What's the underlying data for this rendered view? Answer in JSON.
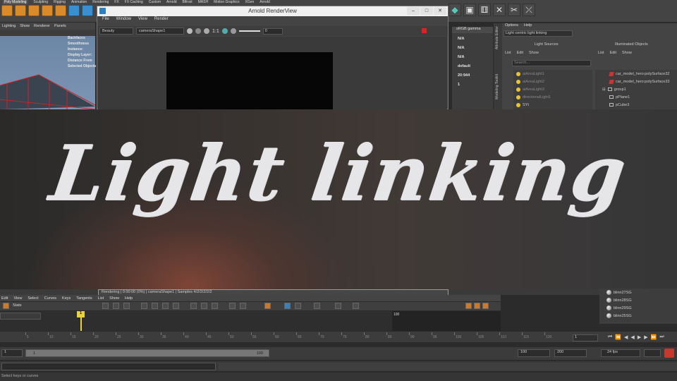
{
  "title_overlay": {
    "text": "Light linking"
  },
  "shelf": {
    "tabs": [
      "Poly Modeling",
      "Sculpting",
      "Rigging",
      "Animation",
      "Rendering",
      "FX",
      "FX Caching",
      "Custom",
      "Arnold",
      "Bifrost",
      "MASH",
      "Motion Graphics",
      "XGen",
      "Arnold"
    ],
    "active_tab": 0
  },
  "viewport": {
    "menus": [
      "Lighting",
      "Show",
      "Renderer",
      "Panels"
    ],
    "hud": [
      "Backfaces",
      "Smoothness",
      "Instance:",
      "Display Layer:",
      "Distance From",
      "Selected Objects"
    ]
  },
  "render_view": {
    "title": "Arnold RenderView",
    "menus": [
      "File",
      "Window",
      "View",
      "Render"
    ],
    "aov": "Beauty",
    "camera": "cameraShape1",
    "ratio": "1:1",
    "exposure": "0",
    "color_space": "sRGB gamma",
    "status": "Rendering | 0:00:00 (0%) | cameraShape1 | Samples 4/2/2/2/2/2"
  },
  "attr_values": [
    "N/A",
    "N/A",
    "N/A",
    "default",
    "20:944",
    "1"
  ],
  "side_tabs": [
    "Attribute Editor",
    "Modeling Toolkit"
  ],
  "light_linking": {
    "menus": [
      "Options",
      "Help"
    ],
    "mode": "Light centric light linking",
    "light_sources_title": "Light Sources",
    "illuminated_title": "Illuminated Objects",
    "light_menus": [
      "List",
      "Edit",
      "Show"
    ],
    "illum_menus": [
      "List",
      "Edit",
      "Show"
    ],
    "search_placeholder": "Search...",
    "lights": [
      "aiAreaLight1",
      "aiAreaLight2",
      "aiAreaLight3",
      "directionalLight1",
      "SYt"
    ],
    "objects": [
      "car_model_hero:polySurface32",
      "car_model_hero:polySurface33",
      "group1",
      "pPlane1",
      "pCube3"
    ]
  },
  "graph_editor": {
    "menus": [
      "Edit",
      "View",
      "Select",
      "Curves",
      "Keys",
      "Tangents",
      "List",
      "Show",
      "Help"
    ],
    "stats_label": "Stats",
    "current_frame": "1",
    "marker_end": "100"
  },
  "hypershade_items": [
    "blinn27SG",
    "blinn28SG",
    "blinn29SG",
    "blinn25SG",
    "blinn26SG"
  ],
  "timeline": {
    "end_field": "1",
    "tick_labels": [
      "5",
      "10",
      "15",
      "20",
      "25",
      "30",
      "35",
      "40",
      "45",
      "50",
      "55",
      "60",
      "65",
      "70",
      "75",
      "80",
      "85",
      "90",
      "95",
      "100",
      "105",
      "110",
      "115",
      "120"
    ]
  },
  "range": {
    "start": "1",
    "inner_start": "1",
    "inner_end": "100",
    "end": "100",
    "max": "200",
    "fps": "24 fps"
  },
  "help_line": "Select keys or curves"
}
